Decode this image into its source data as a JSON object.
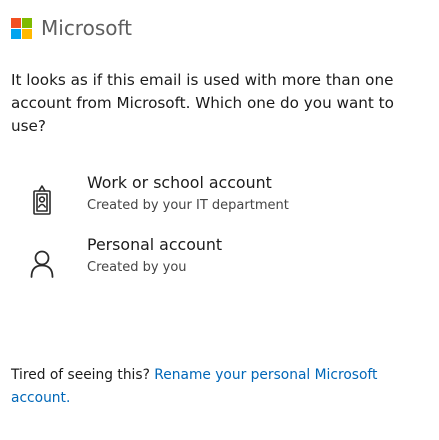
{
  "brand": {
    "name": "Microsoft",
    "logo_colors": [
      "#f25022",
      "#7fba00",
      "#00a4ef",
      "#ffb900"
    ]
  },
  "prompt": {
    "text": "It looks as if this email is used with more than one account from Microsoft. Which one do you want to use?"
  },
  "accounts": [
    {
      "title": "Work or school account",
      "subtitle": "Created by your IT department",
      "icon": "work-badge-icon"
    },
    {
      "title": "Personal account",
      "subtitle": "Created by you",
      "icon": "person-icon"
    }
  ],
  "footer": {
    "text": "Tired of seeing this?",
    "link": "Rename your personal Microsoft account."
  },
  "colors": {
    "link": "#0067b8",
    "text": "#1b1b1b"
  }
}
